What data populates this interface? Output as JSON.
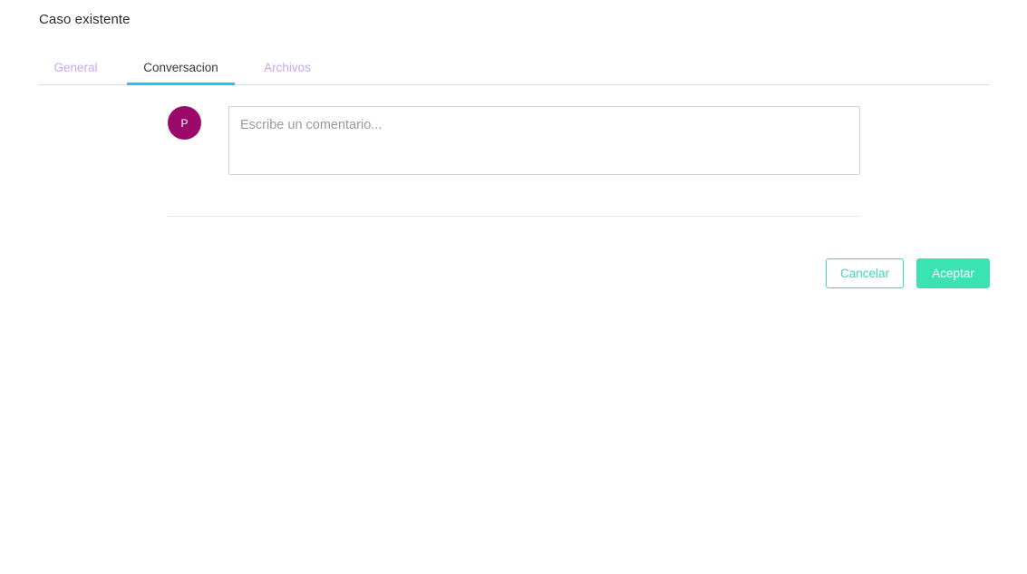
{
  "dialog": {
    "title": "Caso existente"
  },
  "tabs": [
    {
      "label": "General",
      "active": false
    },
    {
      "label": "Conversacion",
      "active": true
    },
    {
      "label": "Archivos",
      "active": false
    }
  ],
  "comment": {
    "avatar_initial": "P",
    "placeholder": "Escribe un comentario...",
    "value": ""
  },
  "actions": {
    "cancel_label": "Cancelar",
    "accept_label": "Aceptar"
  },
  "colors": {
    "tab_inactive": "#c9a8ec",
    "tab_active_indicator": "#1fc6e8",
    "avatar_bg": "#9b0a6a",
    "accent_green": "#3ce3b2"
  }
}
